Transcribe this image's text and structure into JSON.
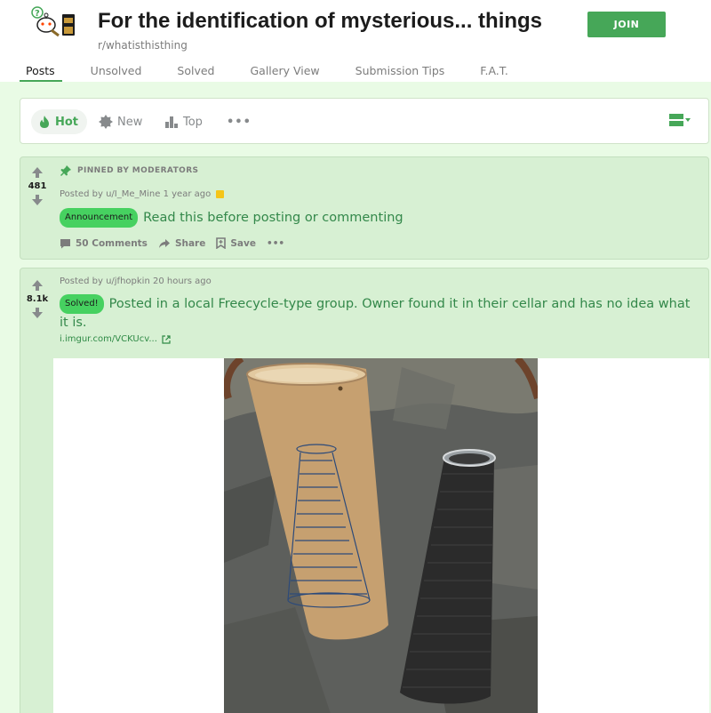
{
  "header": {
    "title": "For the identification of mysterious... things",
    "subreddit": "r/whatisthisthing",
    "join_label": "JOIN"
  },
  "tabs": [
    {
      "label": "Posts",
      "active": true
    },
    {
      "label": "Unsolved"
    },
    {
      "label": "Solved"
    },
    {
      "label": "Gallery View"
    },
    {
      "label": "Submission Tips"
    },
    {
      "label": "F.A.T."
    }
  ],
  "sort": {
    "hot": "Hot",
    "new": "New",
    "top": "Top",
    "more": "•••",
    "accent": "#46a758"
  },
  "posts": [
    {
      "pinned_label": "PINNED BY MODERATORS",
      "votes": "481",
      "posted_by": "Posted by",
      "user": "u/I_Me_Mine",
      "time": "1 year ago",
      "flair": "Announcement",
      "title": "Read this before posting or commenting",
      "comments": "50 Comments",
      "share": "Share",
      "save": "Save",
      "more": "•••"
    },
    {
      "votes": "8.1k",
      "posted_by": "Posted by",
      "user": "u/jfhopkin",
      "time": "20 hours ago",
      "flair": "Solved!",
      "title": "Posted in a local Freecycle-type group. Owner found it in their cellar and has no idea what it is.",
      "link": "i.imgur.com/VCKUcv..."
    }
  ],
  "colors": {
    "background": "#e9fbe5",
    "post_bg": "#d7f0d3",
    "title_green": "#33884a",
    "flair_green": "#46d160"
  }
}
